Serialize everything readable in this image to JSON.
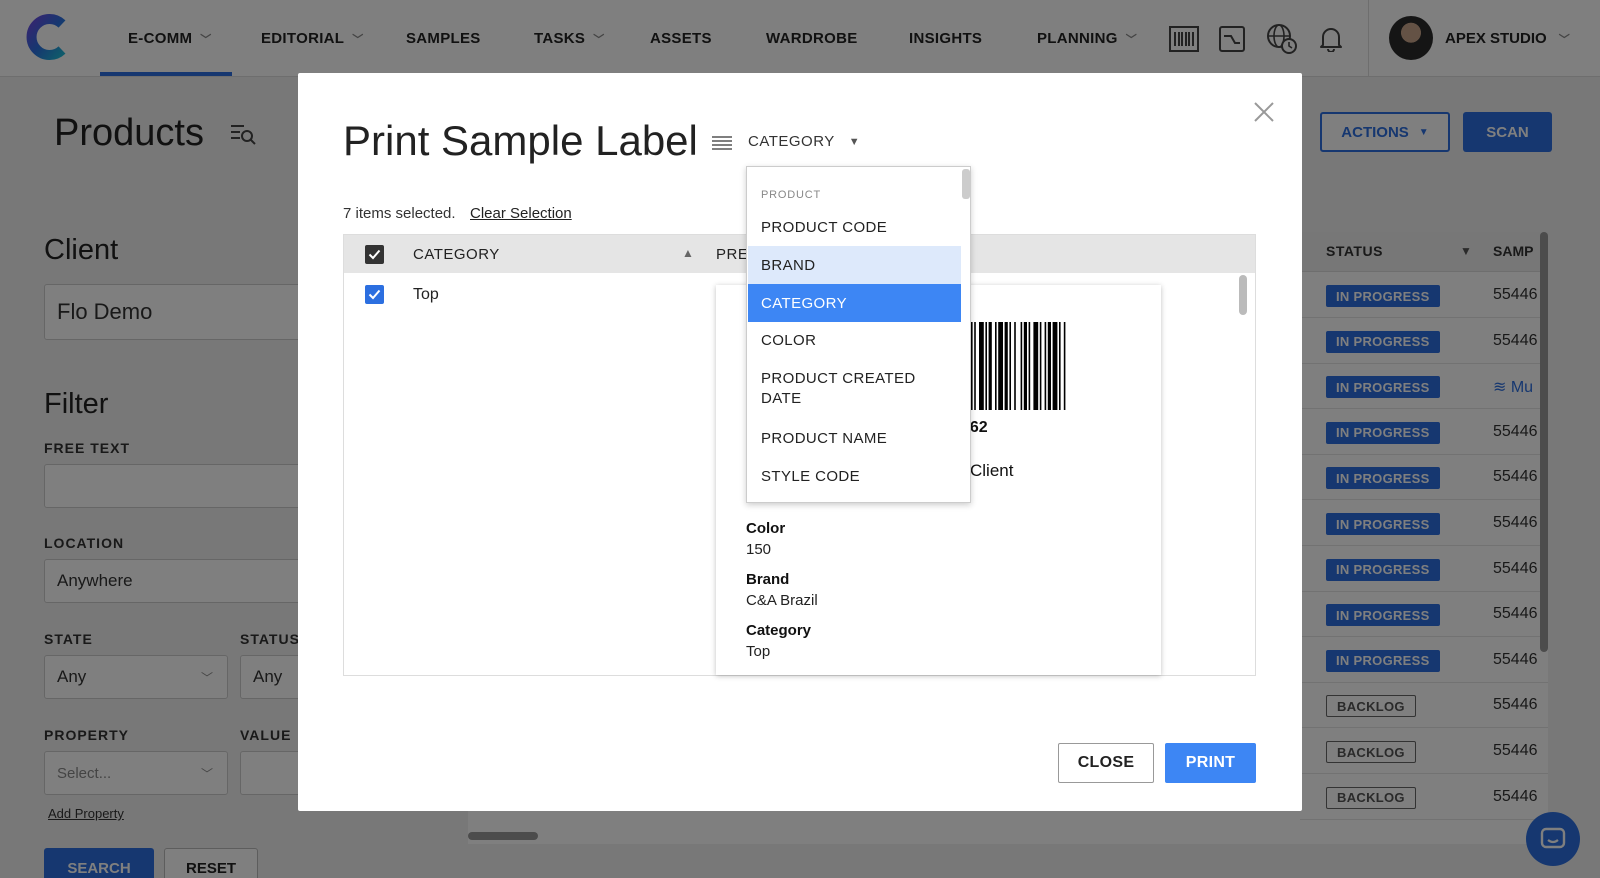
{
  "nav": {
    "items": [
      {
        "label": "E-COMM",
        "chevron": true
      },
      {
        "label": "EDITORIAL",
        "chevron": true
      },
      {
        "label": "SAMPLES",
        "chevron": false
      },
      {
        "label": "TASKS",
        "chevron": true
      },
      {
        "label": "ASSETS",
        "chevron": false
      },
      {
        "label": "WARDROBE",
        "chevron": false
      },
      {
        "label": "INSIGHTS",
        "chevron": false
      },
      {
        "label": "PLANNING",
        "chevron": true
      }
    ],
    "icons": [
      "barcode-icon",
      "chart-icon",
      "globe-clock-icon",
      "bell-icon"
    ],
    "studio": "APEX STUDIO",
    "accent": "#2c6fe0"
  },
  "page": {
    "title": "Products",
    "actions_label": "ACTIONS",
    "scan_label": "SCAN",
    "client_heading": "Client",
    "client_value": "Flo Demo",
    "filter_heading": "Filter",
    "free_text_label": "FREE TEXT",
    "free_text_value": "",
    "location_label": "LOCATION",
    "location_value": "Anywhere",
    "state_label": "STATE",
    "state_value": "Any",
    "status_label": "STATUS",
    "status_value": "Any",
    "property_label": "PROPERTY",
    "property_placeholder": "Select...",
    "value_label": "VALUE",
    "add_property": "Add Property",
    "search_label": "SEARCH",
    "reset_label": "RESET"
  },
  "bg_table": {
    "status_header": "STATUS",
    "samp_header": "SAMP",
    "rows": [
      {
        "status": "IN PROGRESS",
        "kind": "prog",
        "samp": "55446"
      },
      {
        "status": "IN PROGRESS",
        "kind": "prog",
        "samp": "55446"
      },
      {
        "status": "IN PROGRESS",
        "kind": "prog",
        "samp": "≋ Mu",
        "link": true
      },
      {
        "status": "IN PROGRESS",
        "kind": "prog",
        "samp": "55446"
      },
      {
        "status": "IN PROGRESS",
        "kind": "prog",
        "samp": "55446"
      },
      {
        "status": "IN PROGRESS",
        "kind": "prog",
        "samp": "55446"
      },
      {
        "status": "IN PROGRESS",
        "kind": "prog",
        "samp": "55446"
      },
      {
        "status": "IN PROGRESS",
        "kind": "prog",
        "samp": "55446"
      },
      {
        "status": "IN PROGRESS",
        "kind": "prog",
        "samp": "55446"
      },
      {
        "status": "BACKLOG",
        "kind": "back",
        "samp": "55446"
      },
      {
        "status": "BACKLOG",
        "kind": "back",
        "samp": "55446"
      },
      {
        "status": "BACKLOG",
        "kind": "back",
        "samp": "55446"
      }
    ]
  },
  "modal": {
    "title": "Print Sample Label",
    "selected_field": "CATEGORY",
    "items_selected": "7 items selected.",
    "clear_selection": "Clear Selection",
    "table": {
      "col_category": "CATEGORY",
      "col_preview": "PREV",
      "rows": [
        {
          "category": "Top",
          "checked": true
        }
      ]
    },
    "preview": {
      "barcode_number": "762",
      "client_text": "Client",
      "fields": [
        {
          "label": "Color",
          "value": "150"
        },
        {
          "label": "Brand",
          "value": "C&A Brazil"
        },
        {
          "label": "Category",
          "value": "Top"
        }
      ]
    },
    "close_label": "CLOSE",
    "print_label": "PRINT",
    "print_color": "#3d86f4"
  },
  "dropdown": {
    "group_label": "PRODUCT",
    "options": [
      {
        "label": "PRODUCT CODE",
        "state": "normal"
      },
      {
        "label": "BRAND",
        "state": "hover"
      },
      {
        "label": "CATEGORY",
        "state": "selected"
      },
      {
        "label": "COLOR",
        "state": "normal"
      },
      {
        "label": "PRODUCT CREATED DATE",
        "state": "normal"
      },
      {
        "label": "PRODUCT NAME",
        "state": "normal"
      },
      {
        "label": "STYLE CODE",
        "state": "normal"
      }
    ]
  }
}
